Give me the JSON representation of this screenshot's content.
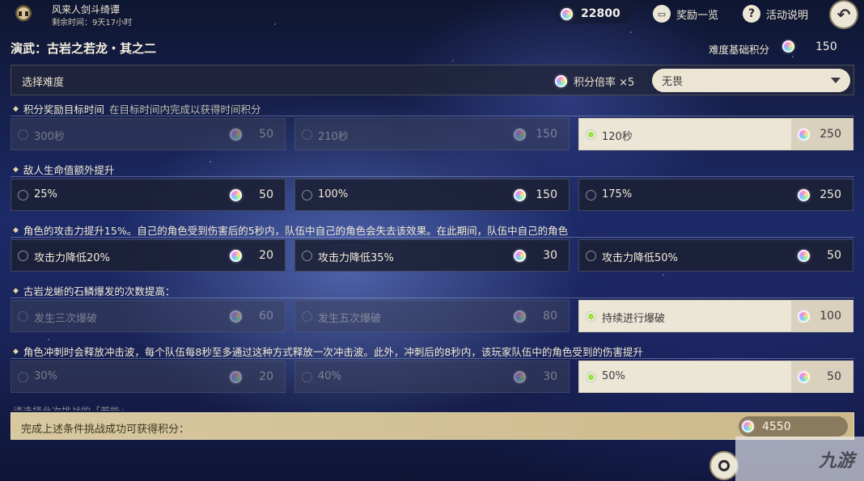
{
  "event": {
    "title": "风来人剑斗绮谭",
    "remaining_time": "剩余时间：9天17小时"
  },
  "topbar": {
    "currency_value": "22800",
    "rewards_label": "奖励一览",
    "help_label": "活动说明",
    "help_glyph": "?",
    "back_glyph": "↶"
  },
  "stage": {
    "title": "演武：古岩之若龙・其之二",
    "base_score_label": "难度基础积分",
    "base_score": "150"
  },
  "difficulty": {
    "label": "选择难度",
    "multiplier": "积分倍率 ×5",
    "selected": "无畏"
  },
  "sections": [
    {
      "title": "积分奖励目标时间",
      "subtitle": "在目标时间内完成以获得时间积分",
      "options": [
        {
          "label": "300秒",
          "score": "50",
          "state": "disabled"
        },
        {
          "label": "210秒",
          "score": "150",
          "state": "disabled"
        },
        {
          "label": "120秒",
          "score": "250",
          "state": "selected"
        }
      ]
    },
    {
      "title": "敌人生命值额外提升",
      "subtitle": "",
      "options": [
        {
          "label": "25%",
          "score": "50",
          "state": "normal"
        },
        {
          "label": "100%",
          "score": "150",
          "state": "normal"
        },
        {
          "label": "175%",
          "score": "250",
          "state": "normal"
        }
      ]
    },
    {
      "title": "角色的攻击力提升15%。自己的角色受到伤害后的5秒内，队伍中自己的角色会失去该效果。在此期间，队伍中自己的角色",
      "subtitle": "",
      "options": [
        {
          "label": "攻击力降低20%",
          "score": "20",
          "state": "normal"
        },
        {
          "label": "攻击力降低35%",
          "score": "30",
          "state": "normal"
        },
        {
          "label": "攻击力降低50%",
          "score": "50",
          "state": "normal"
        }
      ]
    },
    {
      "title": "古岩龙蜥的石鳞爆发的次数提高：",
      "subtitle": "",
      "options": [
        {
          "label": "发生三次爆破",
          "score": "60",
          "state": "disabled"
        },
        {
          "label": "发生五次爆破",
          "score": "80",
          "state": "disabled"
        },
        {
          "label": "持续进行爆破",
          "score": "100",
          "state": "selected"
        }
      ]
    },
    {
      "title": "角色冲刺时会释放冲击波，每个队伍每8秒至多通过这种方式释放一次冲击波。此外，冲刺后的8秒内，该玩家队伍中的角色受到的伤害提升",
      "subtitle": "",
      "options": [
        {
          "label": "30%",
          "score": "20",
          "state": "disabled"
        },
        {
          "label": "40%",
          "score": "30",
          "state": "disabled"
        },
        {
          "label": "50%",
          "score": "50",
          "state": "selected"
        }
      ]
    }
  ],
  "next_section_peek": "请选择此次挑战的「若能」",
  "total": {
    "label": "完成上述条件挑战成功可获得积分：",
    "value": "4550"
  },
  "watermark": "九游",
  "colors": {
    "selected_radio": "#9ee04a",
    "selected_bg": "#ece6d6",
    "total_bar": "#d8c8a0"
  }
}
